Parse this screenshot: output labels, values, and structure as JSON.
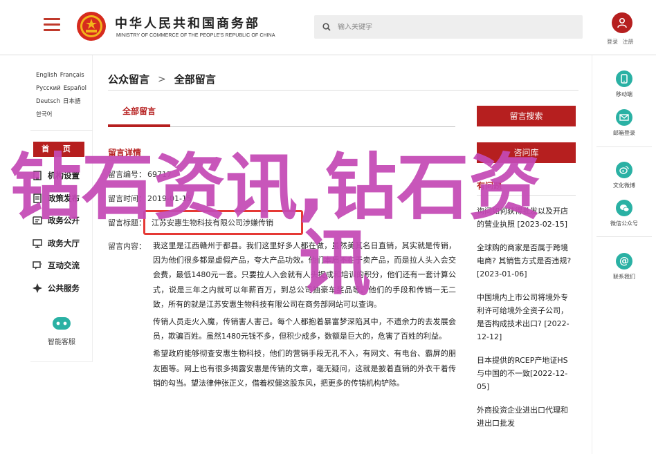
{
  "header": {
    "brand_cn": "中华人民共和国商务部",
    "brand_en": "MINISTRY OF COMMERCE OF THE PEOPLE'S REPUBLIC OF CHINA",
    "search_placeholder": "输入关键字",
    "login_label": "登录",
    "register_label": "注册"
  },
  "sidebar": {
    "languages": [
      [
        "English",
        "Français"
      ],
      [
        "Русский",
        "Español"
      ],
      [
        "Deutsch",
        "日本語"
      ],
      [
        "한국어",
        ""
      ]
    ],
    "home_label": "首 页",
    "items": [
      {
        "label": "机构设置",
        "icon": "building-icon"
      },
      {
        "label": "政策发布",
        "icon": "document-icon"
      },
      {
        "label": "政务公开",
        "icon": "gov-affairs-icon"
      },
      {
        "label": "政务大厅",
        "icon": "monitor-icon"
      },
      {
        "label": "互动交流",
        "icon": "chat-icon"
      },
      {
        "label": "公共服务",
        "icon": "service-icon"
      }
    ],
    "mini_program_label": "智能客服"
  },
  "main": {
    "breadcrumb_1": "公众留言",
    "breadcrumb_sep": ">",
    "breadcrumb_2": "全部留言",
    "tab_label": "全部留言",
    "detail_title": "留言详情",
    "field_number_label": "留言编号：",
    "field_number_value": "69717",
    "field_time_label": "留言时间：",
    "field_time_value": "2019-01-15",
    "field_title_label": "留言标题：",
    "field_title_value": "江苏安惠生物科技有限公司涉嫌传销",
    "content_label": "留言内容：",
    "paragraphs": [
      "我这里是江西赣州于都县。我们这里好多人都在做，虽然美其名日直销，其实就是传销，因为他们很多都是虚假产品，夸大产品功效。他们本质不在于卖产品，而是拉人头入会交会费，最低1480元一套。只要拉人入会就有人头提成和培训的积分，他们还有一套计算公式，说是三年之内就可以年薪百万，到总公司抽豪车奖品等。他们的手段和传销一无二致，所有的就是江苏安惠生物科技有限公司在商务部网站可以查询。",
      "传销人员走火入魔，传销害人害己。每个人都抱着暴富梦深陷其中，不遗余力的去发展会员，欺骗百姓。虽然1480元钱不多，但积少成多，数额是巨大的，危害了百姓的利益。",
      "希望政府能够彻查安惠生物科技，他们的营销手段无孔不入，有网文、有电台、霸屏的朋友圈等。网上也有很多揭露安惠是传销的文章，毫无疑问，这就是披着直销的外衣干着传销的勾当。望法律伸张正义，借着权健这股东风，把更多的传销机构铲除。"
    ]
  },
  "right_panel": {
    "search_button": "留言搜索",
    "faq_button": "咨问库",
    "hot_title": "有问题",
    "hot_items": [
      "询问如何获得批发以及开店的营业执照 [2023-02-15]",
      "全球购的商家是否属于跨境电商? 其销售方式是否违规? [2023-01-06]",
      "中国境内上市公司将境外专利许可给境外全资子公司，是否构成技术出口? [2022-12-12]",
      "日本提供的RCEP产地证HS与中国的不一致[2022-12-05]",
      "外商投资企业进出口代理和进出口批发"
    ]
  },
  "right_nav": [
    {
      "label": "移动端",
      "icon": "mobile-icon"
    },
    {
      "label": "邮箱登录",
      "icon": "mail-icon"
    },
    {
      "label": "文化微博",
      "icon": "weibo-icon"
    },
    {
      "label": "微信公众号",
      "icon": "wechat-icon"
    },
    {
      "label": "联系我们",
      "icon": "at-icon"
    }
  ],
  "watermark": {
    "line1": "钻石资讯,钻石资",
    "line2": "讯"
  },
  "colors": {
    "brand_red": "#b61f1f",
    "watermark": "#c449b5",
    "teal": "#2ab1a4"
  }
}
